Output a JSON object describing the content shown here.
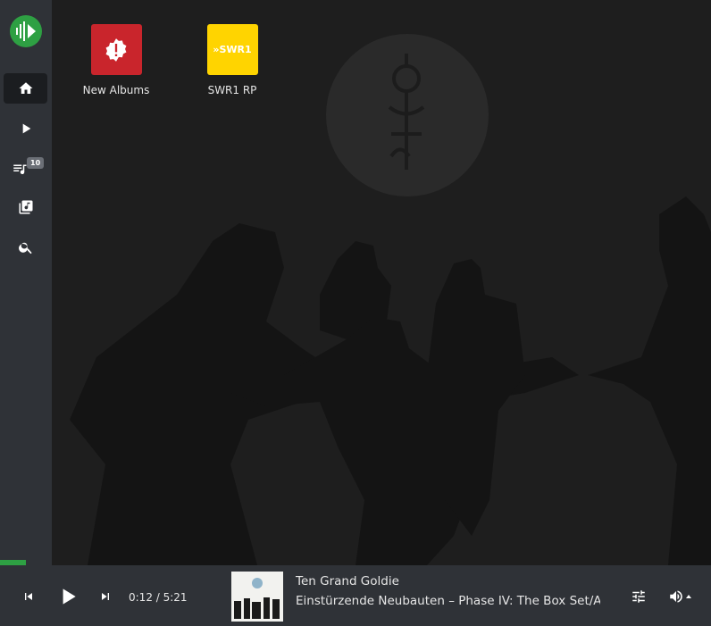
{
  "colors": {
    "accent": "#2ea043",
    "sidebar_bg": "#2f3237",
    "main_bg": "#1e1e1e",
    "alert_tile": "#c9252c",
    "swr_tile": "#ffd400"
  },
  "sidebar": {
    "logo_icon": "audio-waveform-play-icon",
    "items": [
      {
        "name": "home",
        "icon": "home-icon",
        "active": true
      },
      {
        "name": "now-playing",
        "icon": "play-icon"
      },
      {
        "name": "queue",
        "icon": "queue-icon",
        "badge": "10"
      },
      {
        "name": "library",
        "icon": "library-music-icon"
      },
      {
        "name": "search",
        "icon": "search-icon"
      }
    ]
  },
  "main": {
    "tiles": [
      {
        "label": "New Albums",
        "icon": "alert-badge-icon"
      },
      {
        "label": "SWR1 RP",
        "logo_text": "»SWR1"
      }
    ]
  },
  "player": {
    "progress": 0.037,
    "time": "0:12 / 5:21",
    "track_title": "Ten Grand Goldie",
    "track_artist": "Einstürzende Neubauten – Phase IV: The Box Set/Alles",
    "controls": [
      "previous-icon",
      "play-icon",
      "next-icon",
      "equalizer-icon",
      "volume-icon"
    ]
  }
}
